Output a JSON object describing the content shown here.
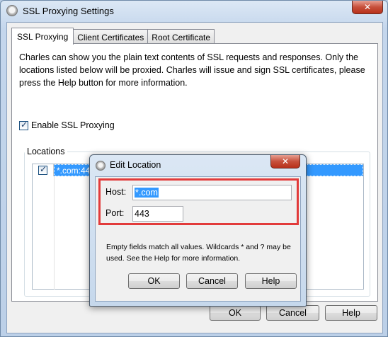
{
  "window": {
    "title": "SSL Proxying Settings",
    "close_glyph": "✕"
  },
  "tabs": [
    {
      "label": "SSL Proxying",
      "active": true
    },
    {
      "label": "Client Certificates",
      "active": false
    },
    {
      "label": "Root Certificate",
      "active": false
    }
  ],
  "ssl_panel": {
    "description": "Charles can show you the plain text contents of SSL requests and responses. Only the locations listed below will be proxied. Charles will issue and sign SSL certificates, please press the Help button for more information.",
    "enable_label": "Enable SSL Proxying",
    "enable_checked": true,
    "locations_label": "Locations",
    "locations": [
      {
        "enabled": true,
        "location": "*.com:443"
      }
    ]
  },
  "main_buttons": {
    "ok": "OK",
    "cancel": "Cancel",
    "help": "Help"
  },
  "dialog": {
    "title": "Edit Location",
    "close_glyph": "✕",
    "host_label": "Host:",
    "host_value": "*.com",
    "port_label": "Port:",
    "port_value": "443",
    "help_text": "Empty fields match all values. Wildcards * and ? may be used. See the Help for more information.",
    "ok": "OK",
    "cancel": "Cancel",
    "help": "Help"
  },
  "colors": {
    "selection": "#3399ff",
    "highlight_box": "#e23b3b"
  }
}
